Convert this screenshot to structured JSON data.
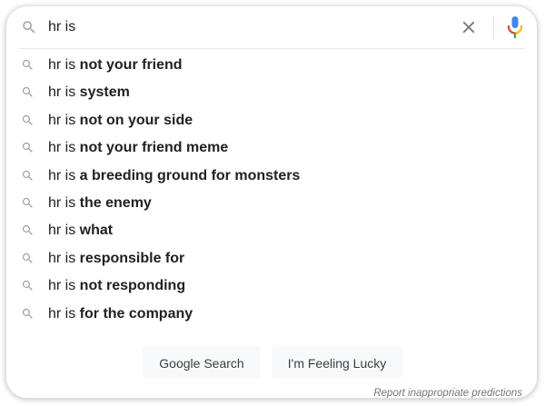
{
  "search": {
    "query": "hr is",
    "icon": "search-icon",
    "clear_icon": "close-icon",
    "mic_icon": "microphone-icon",
    "mic_colors": [
      "#4285f4",
      "#ea4335",
      "#fbbc05",
      "#34a853"
    ]
  },
  "suggestions": [
    {
      "prefix": "hr is ",
      "completion": "not your friend"
    },
    {
      "prefix": "hr is ",
      "completion": "system"
    },
    {
      "prefix": "hr is ",
      "completion": "not on your side"
    },
    {
      "prefix": "hr is ",
      "completion": "not your friend meme"
    },
    {
      "prefix": "hr is ",
      "completion": "a breeding ground for monsters"
    },
    {
      "prefix": "hr is ",
      "completion": "the enemy"
    },
    {
      "prefix": "hr is ",
      "completion": "what"
    },
    {
      "prefix": "hr is ",
      "completion": "responsible for"
    },
    {
      "prefix": "hr is ",
      "completion": "not responding"
    },
    {
      "prefix": "hr is ",
      "completion": "for the company"
    }
  ],
  "buttons": {
    "search_label": "Google Search",
    "lucky_label": "I'm Feeling Lucky"
  },
  "footer": {
    "report_label": "Report inappropriate predictions"
  }
}
